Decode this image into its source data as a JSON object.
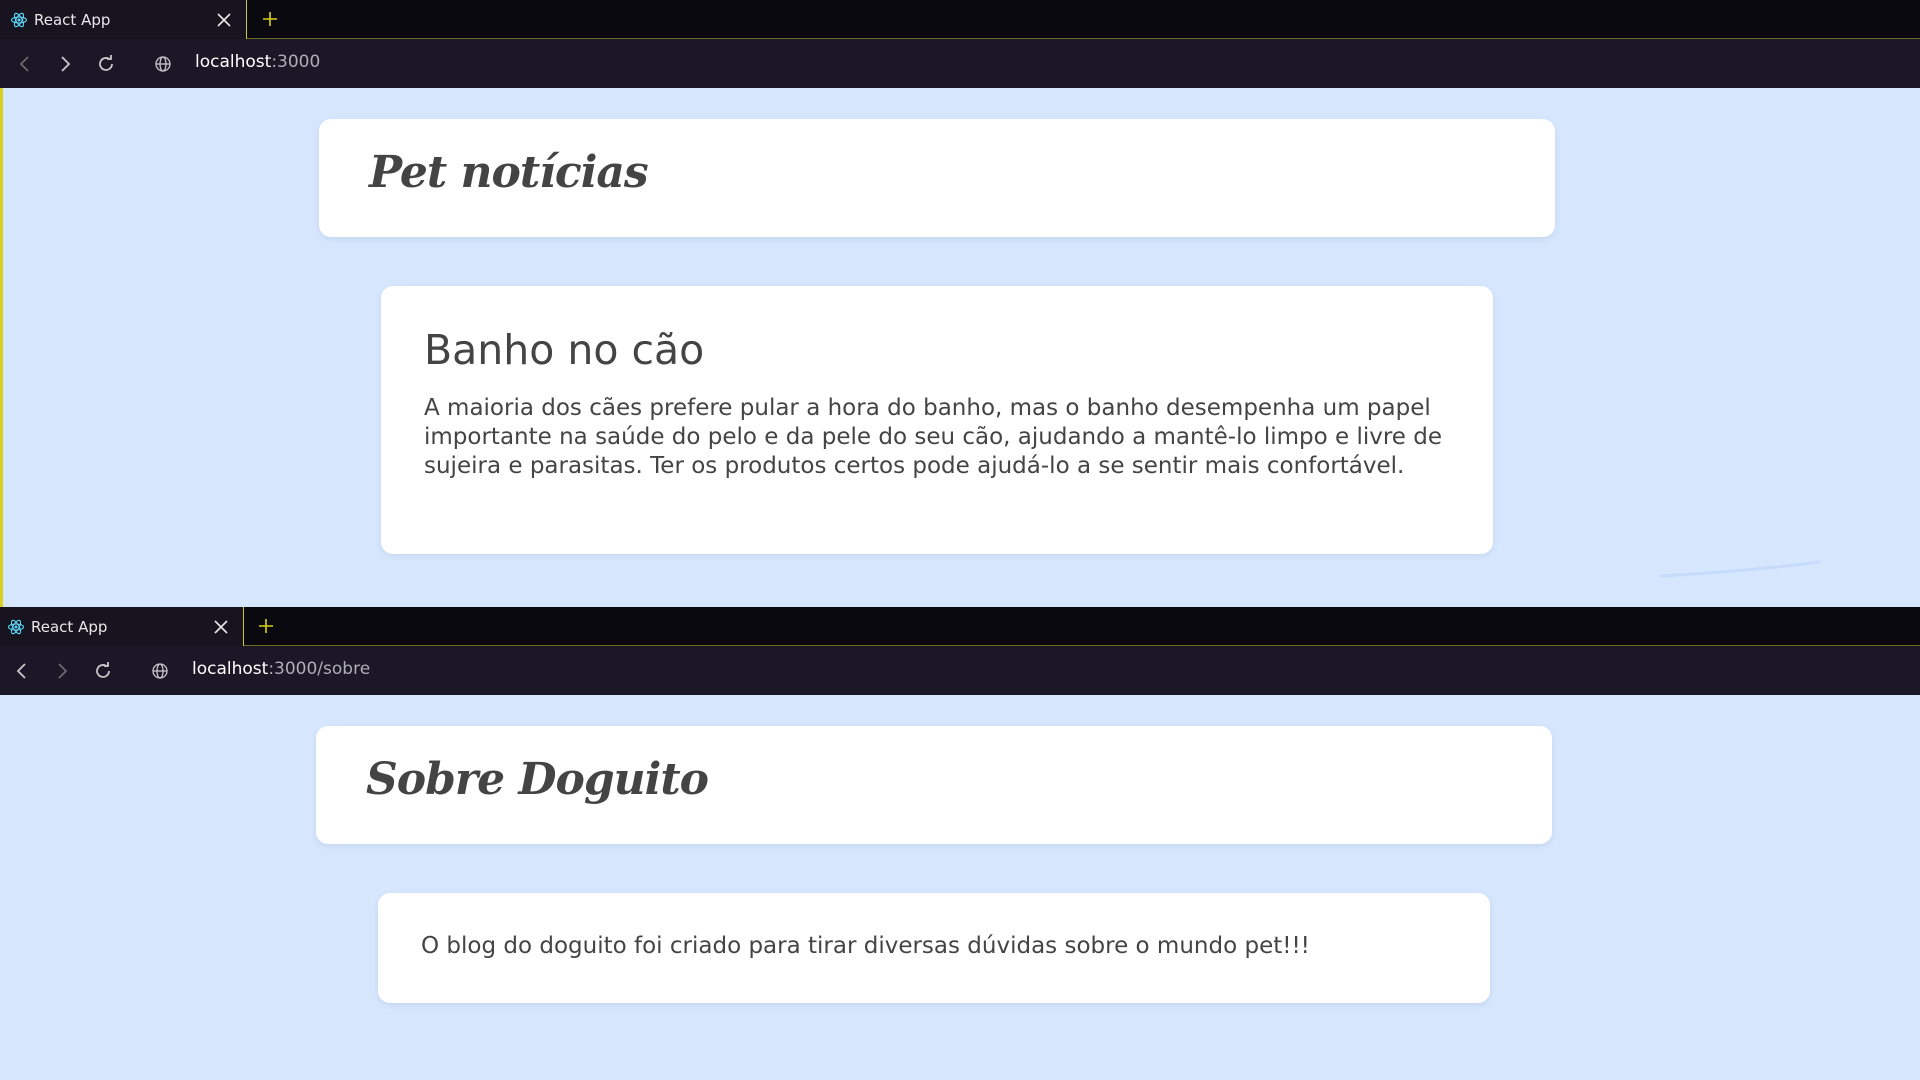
{
  "window1": {
    "tab": {
      "title": "React App",
      "favicon": "react-icon"
    },
    "url": {
      "host": "localhost",
      "rest": ":3000"
    },
    "header": {
      "title": "Pet notícias"
    },
    "post": {
      "title": "Banho no cão",
      "body": "A maioria dos cães prefere pular a hora do banho, mas o banho desempenha um papel importante na saúde do pelo e da pele do seu cão, ajudando a mantê-lo limpo e livre de sujeira e parasitas. Ter os produtos certos pode ajudá-lo a se sentir mais confortável."
    }
  },
  "window2": {
    "tab": {
      "title": "React App",
      "favicon": "react-icon"
    },
    "url": {
      "host": "localhost",
      "rest": ":3000/sobre"
    },
    "header": {
      "title": "Sobre Doguito"
    },
    "about": {
      "text": "O blog do doguito foi criado para tirar diversas dúvidas sobre o mundo pet!!!"
    }
  },
  "colors": {
    "page_background": "#d6e6fd",
    "card_background": "#ffffff",
    "text": "#444444",
    "tabstrip": "#0a090f",
    "toolbar": "#1b1726",
    "accent": "#d9d21c",
    "react_icon": "#61dafb"
  }
}
